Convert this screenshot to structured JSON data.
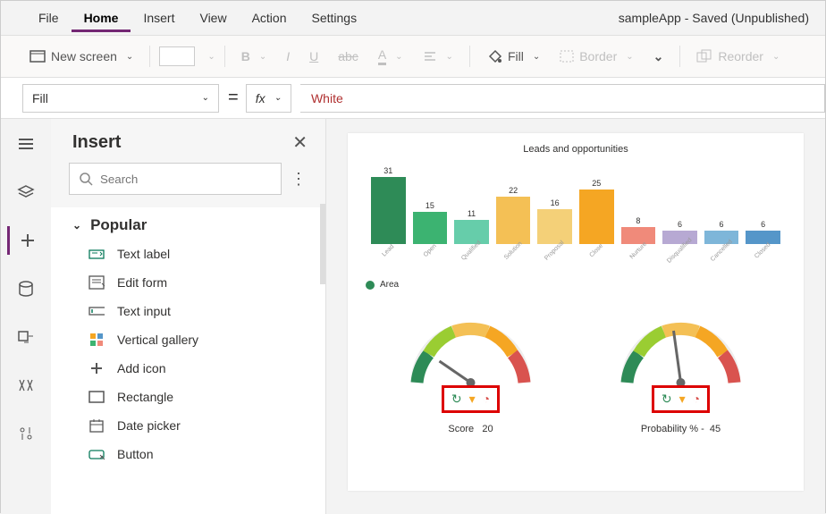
{
  "menu": {
    "items": [
      "File",
      "Home",
      "Insert",
      "View",
      "Action",
      "Settings"
    ],
    "active": "Home",
    "title": "sampleApp - Saved (Unpublished)"
  },
  "ribbon": {
    "newscreen": "New screen",
    "fill": "Fill",
    "border": "Border",
    "reorder": "Reorder"
  },
  "formula": {
    "property": "Fill",
    "equals": "=",
    "fx": "fx",
    "value": "White"
  },
  "insert": {
    "title": "Insert",
    "search_placeholder": "Search",
    "category": "Popular",
    "items": [
      {
        "label": "Text label",
        "icon": "text-label"
      },
      {
        "label": "Edit form",
        "icon": "form"
      },
      {
        "label": "Text input",
        "icon": "text-input"
      },
      {
        "label": "Vertical gallery",
        "icon": "gallery"
      },
      {
        "label": "Add icon",
        "icon": "plus"
      },
      {
        "label": "Rectangle",
        "icon": "rect"
      },
      {
        "label": "Date picker",
        "icon": "date"
      },
      {
        "label": "Button",
        "icon": "button"
      }
    ]
  },
  "chart_data": {
    "type": "bar",
    "title": "Leads and opportunities",
    "categories": [
      "Lead",
      "Open",
      "Qualified",
      "Solution",
      "Proposal",
      "Close",
      "Nurture",
      "Disqualified",
      "Cancelled",
      "Closed"
    ],
    "values": [
      31,
      15,
      11,
      22,
      16,
      25,
      8,
      6,
      6,
      6
    ],
    "colors": [
      "#2e8b57",
      "#3cb371",
      "#66cdaa",
      "#f4c055",
      "#f4d078",
      "#f5a623",
      "#f08a7a",
      "#b7a9d3",
      "#7eb6d9",
      "#5596c9"
    ],
    "legend": "Area",
    "ylim": [
      0,
      35
    ]
  },
  "gauges": [
    {
      "label": "Score",
      "value": 20
    },
    {
      "label": "Probability % -",
      "value": 45
    }
  ]
}
